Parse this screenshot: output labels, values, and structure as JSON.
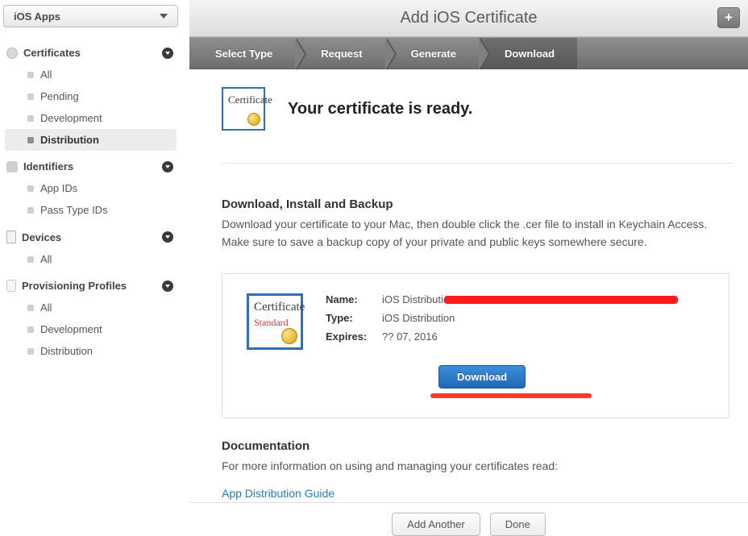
{
  "dropdown": {
    "label": "iOS Apps"
  },
  "page_title": "Add iOS Certificate",
  "steps": [
    {
      "label": "Select Type"
    },
    {
      "label": "Request"
    },
    {
      "label": "Generate"
    },
    {
      "label": "Download",
      "active": true
    }
  ],
  "sidebar": {
    "certificates": {
      "title": "Certificates",
      "items": [
        "All",
        "Pending",
        "Development",
        "Distribution"
      ],
      "selected_index": 3
    },
    "identifiers": {
      "title": "Identifiers",
      "items": [
        "App IDs",
        "Pass Type IDs"
      ]
    },
    "devices": {
      "title": "Devices",
      "items": [
        "All"
      ]
    },
    "profiles": {
      "title": "Provisioning Profiles",
      "items": [
        "All",
        "Development",
        "Distribution"
      ]
    }
  },
  "ready_heading": "Your certificate is ready.",
  "download_section": {
    "title": "Download, Install and Backup",
    "text": "Download your certificate to your Mac, then double click the .cer file to install in Keychain Access. Make sure to save a backup copy of your private and public keys somewhere secure."
  },
  "certificate": {
    "name_label": "Name:",
    "name_value": "iOS Distributio",
    "type_label": "Type:",
    "type_value": "iOS Distribution",
    "expires_label": "Expires:",
    "expires_value": "?? 07, 2016",
    "download_label": "Download"
  },
  "documentation": {
    "title": "Documentation",
    "text": "For more information on using and managing your certificates read:",
    "link_label": "App Distribution Guide"
  },
  "footer": {
    "add_another": "Add Another",
    "done": "Done"
  }
}
